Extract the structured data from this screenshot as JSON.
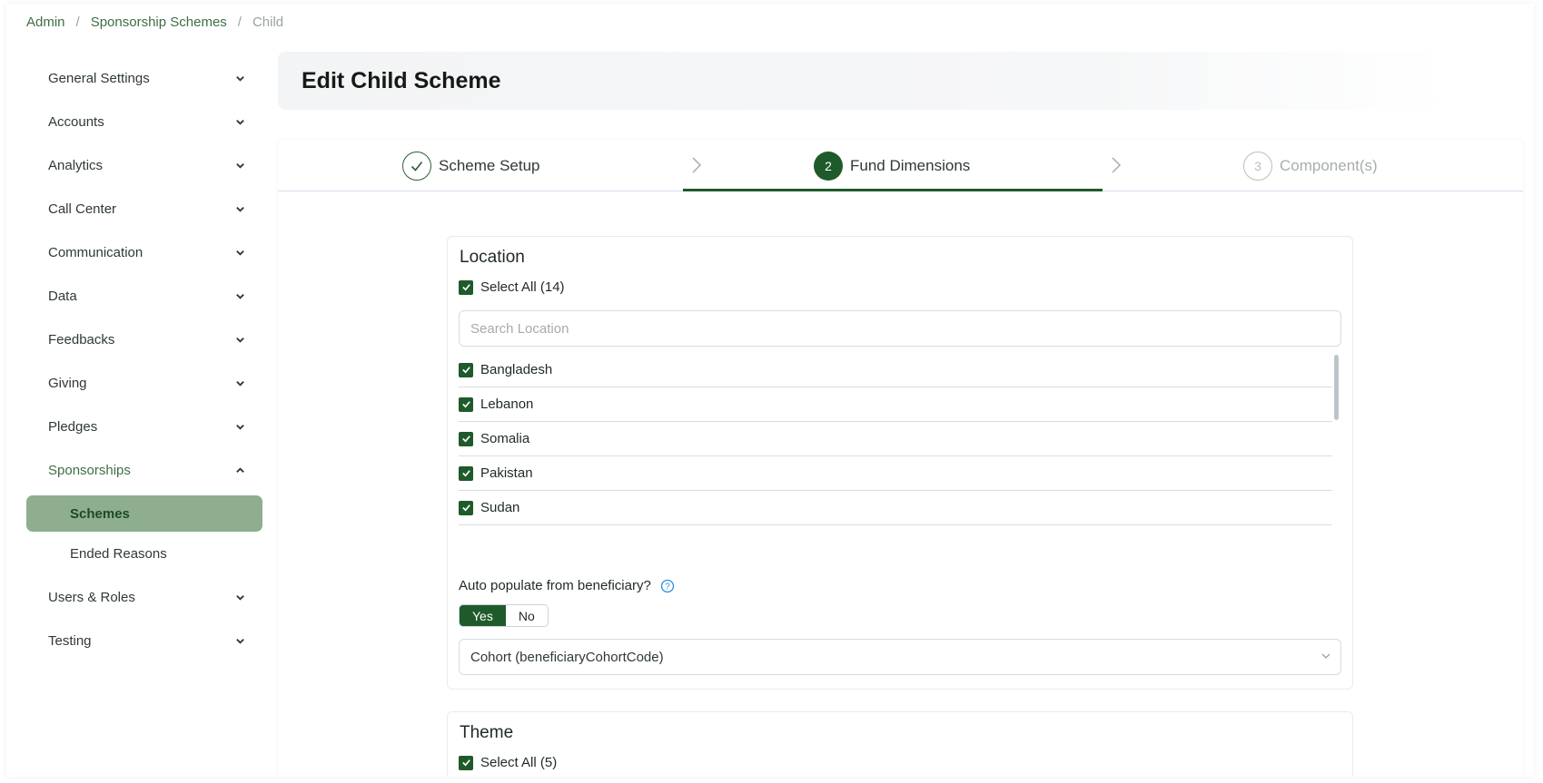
{
  "breadcrumb": [
    "Admin",
    "Sponsorship Schemes",
    "Child"
  ],
  "sidebar": {
    "items": [
      {
        "label": "General Settings"
      },
      {
        "label": "Accounts"
      },
      {
        "label": "Analytics"
      },
      {
        "label": "Call Center"
      },
      {
        "label": "Communication"
      },
      {
        "label": "Data"
      },
      {
        "label": "Feedbacks"
      },
      {
        "label": "Giving"
      },
      {
        "label": "Pledges"
      },
      {
        "label": "Sponsorships",
        "expanded": true,
        "children": [
          {
            "label": "Schemes",
            "active": true
          },
          {
            "label": "Ended Reasons"
          }
        ]
      },
      {
        "label": "Users & Roles"
      },
      {
        "label": "Testing"
      }
    ]
  },
  "page": {
    "title": "Edit Child Scheme"
  },
  "steps": [
    {
      "number": "1",
      "label": "Scheme Setup",
      "state": "done"
    },
    {
      "number": "2",
      "label": "Fund Dimensions",
      "state": "active"
    },
    {
      "number": "3",
      "label": "Component(s)",
      "state": "todo"
    }
  ],
  "location": {
    "title": "Location",
    "select_all": "Select All (14)",
    "search_placeholder": "Search Location",
    "items": [
      "Bangladesh",
      "Lebanon",
      "Somalia",
      "Pakistan",
      "Sudan"
    ],
    "auto_populate_label": "Auto populate from beneficiary?",
    "toggle": {
      "yes": "Yes",
      "no": "No",
      "selected": "Yes"
    },
    "select_value": "Cohort (beneficiaryCohortCode)"
  },
  "theme": {
    "title": "Theme",
    "select_all": "Select All (5)"
  },
  "colors": {
    "accent": "#1f5a2b",
    "active_sub_bg": "#8eae8f",
    "link": "#3e6e46"
  }
}
